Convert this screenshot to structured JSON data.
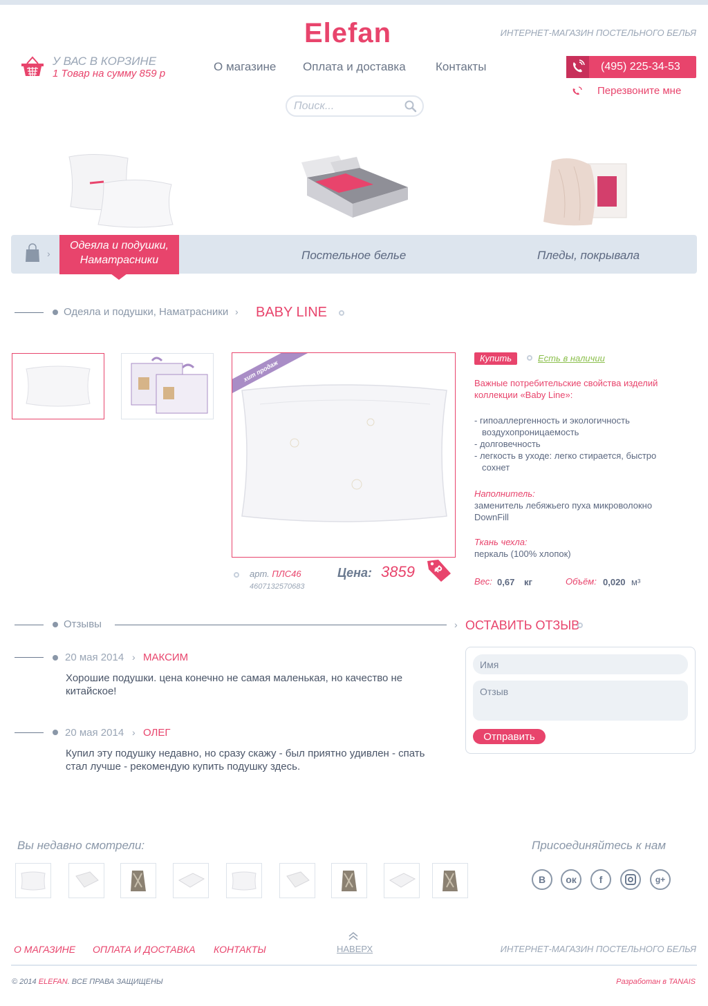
{
  "header": {
    "logo": "Elefan",
    "tagline": "ИНТЕРНЕТ-МАГАЗИН ПОСТЕЛЬНОГО БЕЛЬЯ",
    "cart_title": "У ВАС В КОРЗИНЕ",
    "cart_summary": "1 Товар на сумму 859 р",
    "nav": [
      "О магазине",
      "Оплата и доставка",
      "Контакты"
    ],
    "phone": "(495) 225-34-53",
    "callback": "Перезвоните мне",
    "search_placeholder": "Поиск..."
  },
  "categories": {
    "active_line1": "Одеяла и подушки,",
    "active_line2": "Наматрасники",
    "items": [
      "Постельное белье",
      "Пледы, покрывала"
    ]
  },
  "breadcrumb": {
    "parent": "Одеяла и подушки, Наматрасники",
    "current": "BABY LINE"
  },
  "product": {
    "badge": "хит продаж",
    "buy": "Купить",
    "stock": "Есть в наличии",
    "desc_heading": "Важные потребительские свойства изделий коллекции «Baby Line»:",
    "features": [
      "- гипоаллергенность и экологичность",
      "воздухопроницаемость",
      "- долговечность",
      "- легкость в уходе: легко стирается, быстро",
      "сохнет"
    ],
    "filler_label": "Наполнитель:",
    "filler_value": "заменитель лебяжьего пуха микроволокно DownFill",
    "fabric_label": "Ткань чехла:",
    "fabric_value": "перкаль (100% хлопок)",
    "weight_label": "Вес:",
    "weight_value": "0,67",
    "weight_unit": "кг",
    "volume_label": "Объём:",
    "volume_value": "0,020",
    "volume_unit": "м³",
    "art_label": "арт.",
    "art_value": "ПЛС46",
    "ean": "4607132570683",
    "price_label": "Цена:",
    "price_value": "3859",
    "currency": "₽"
  },
  "reviews": {
    "title": "Отзывы",
    "leave": "ОСТАВИТЬ ОТЗЫВ",
    "items": [
      {
        "date": "20 мая 2014",
        "name": "МАКСИМ",
        "text": "Хорошие подушки. цена конечно не самая маленькая, но качество не китайское!"
      },
      {
        "date": "20 мая 2014",
        "name": "ОЛЕГ",
        "text": "Купил эту подушку недавно, но сразу скажу - был приятно удивлен - спать стал лучше - рекомендую купить подушку здесь."
      }
    ],
    "form": {
      "name_placeholder": "Имя",
      "review_placeholder": "Отзыв",
      "submit": "Отправить"
    }
  },
  "recent": {
    "title": "Вы недавно смотрели:"
  },
  "social": {
    "title": "Присоединяйтесь к нам",
    "icons": [
      "vk-icon",
      "odnoklassniki-icon",
      "facebook-icon",
      "instagram-icon",
      "google-plus-icon"
    ]
  },
  "footer": {
    "links": [
      "О МАГАЗИНЕ",
      "ОПЛАТА И ДОСТАВКА",
      "КОНТАКТЫ"
    ],
    "to_top": "НАВЕРХ",
    "tagline": "ИНТЕРНЕТ-МАГАЗИН ПОСТЕЛЬНОГО БЕЛЬЯ",
    "copyright_prefix": "© 2014",
    "copyright_brand": "ELEFAN",
    "copyright_suffix": ". ВСЕ ПРАВА ЗАЩИЩЕНЫ",
    "developer": "Разработан в TANAIS"
  },
  "colors": {
    "accent": "#e8446c",
    "bar": "#dde5ee",
    "text": "#4a5568"
  }
}
